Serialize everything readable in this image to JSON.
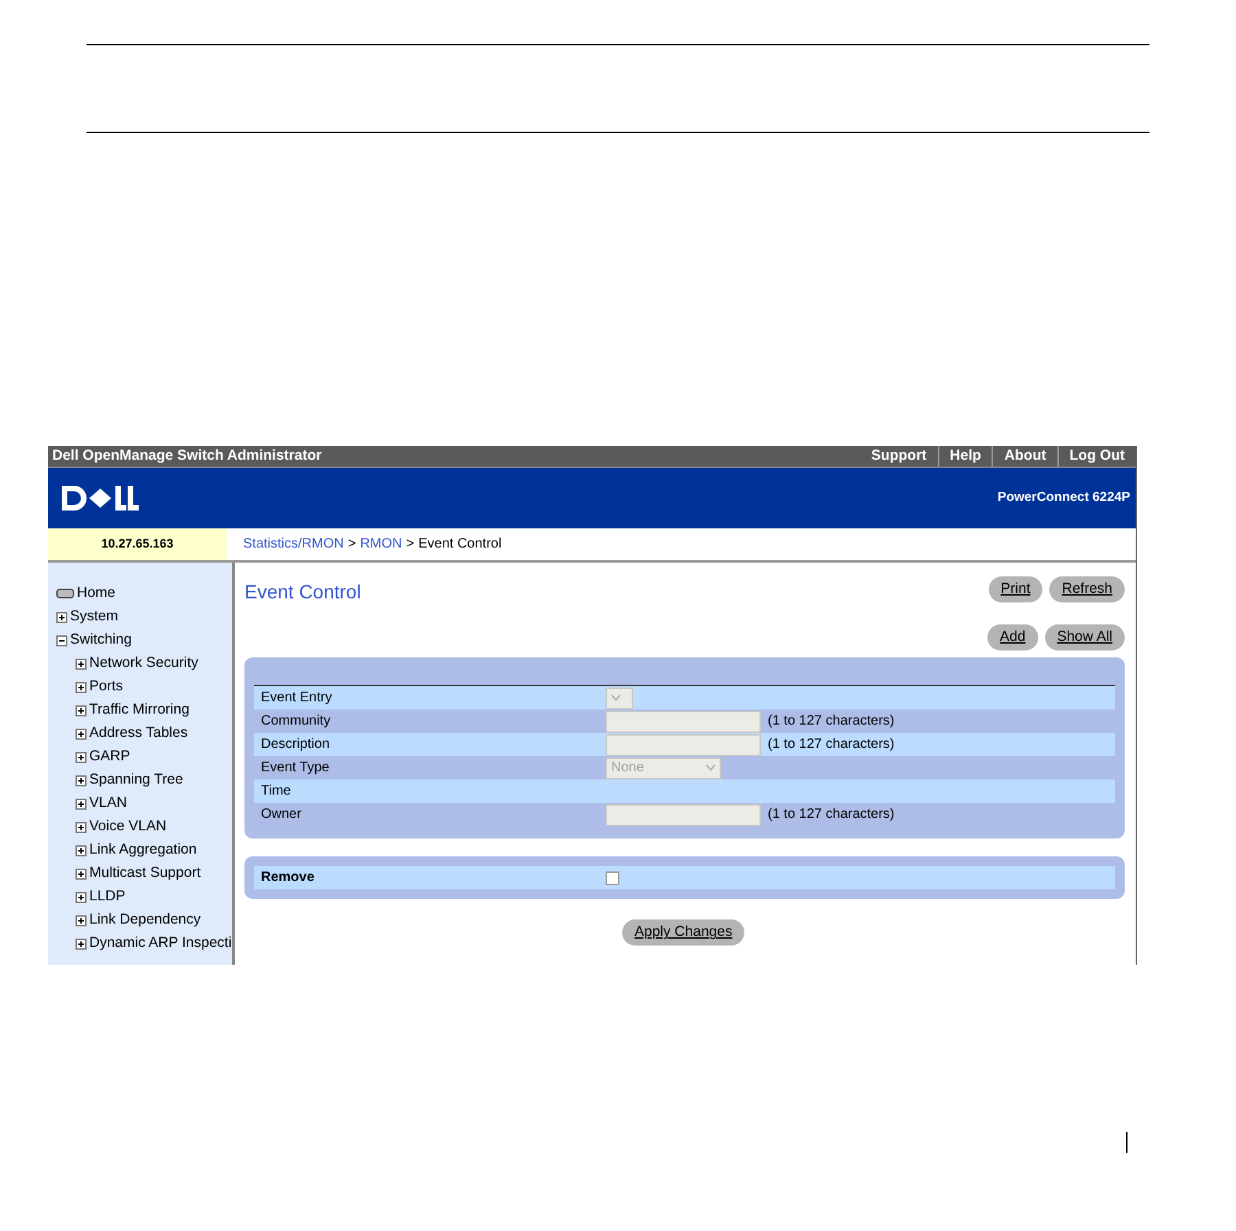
{
  "app_title": "Dell OpenManage Switch Administrator",
  "top_links": [
    "Support",
    "Help",
    "About",
    "Log Out"
  ],
  "product": "PowerConnect 6224P",
  "ip_address": "10.27.65.163",
  "breadcrumb_separator": ">",
  "breadcrumb": [
    {
      "label": "Statistics/RMON",
      "kind": "link"
    },
    {
      "label": "RMON",
      "kind": "link"
    },
    {
      "label": "Event Control",
      "kind": "current"
    }
  ],
  "sidebar": {
    "items": [
      {
        "label": "Home",
        "kind": "home"
      },
      {
        "label": "System",
        "kind": "branch",
        "expanded": false
      },
      {
        "label": "Switching",
        "kind": "branch",
        "expanded": true,
        "children": [
          {
            "label": "Network Security",
            "kind": "branch",
            "expanded": false
          },
          {
            "label": "Ports",
            "kind": "branch",
            "expanded": false
          },
          {
            "label": "Traffic Mirroring",
            "kind": "branch",
            "expanded": false
          },
          {
            "label": "Address Tables",
            "kind": "branch",
            "expanded": false
          },
          {
            "label": "GARP",
            "kind": "branch",
            "expanded": false
          },
          {
            "label": "Spanning Tree",
            "kind": "branch",
            "expanded": false
          },
          {
            "label": "VLAN",
            "kind": "branch",
            "expanded": false
          },
          {
            "label": "Voice VLAN",
            "kind": "branch",
            "expanded": false
          },
          {
            "label": "Link Aggregation",
            "kind": "branch",
            "expanded": false
          },
          {
            "label": "Multicast Support",
            "kind": "branch",
            "expanded": false
          },
          {
            "label": "LLDP",
            "kind": "branch",
            "expanded": false
          },
          {
            "label": "Link Dependency",
            "kind": "branch",
            "expanded": false
          },
          {
            "label": "Dynamic ARP Inspecti",
            "kind": "branch",
            "expanded": false
          }
        ]
      }
    ]
  },
  "page_title": "Event Control",
  "top_buttons": [
    "Print",
    "Refresh"
  ],
  "action_buttons": [
    "Add",
    "Show All"
  ],
  "form_rows": [
    {
      "label": "Event Entry",
      "kind": "select",
      "disabled": true
    },
    {
      "label": "Community",
      "kind": "text",
      "hint": "(1 to 127 characters)",
      "disabled": true
    },
    {
      "label": "Description",
      "kind": "text",
      "hint": "(1 to 127 characters)",
      "disabled": true
    },
    {
      "label": "Event Type",
      "kind": "select",
      "value": "None",
      "disabled": true
    },
    {
      "label": "Time",
      "kind": "none"
    },
    {
      "label": "Owner",
      "kind": "text",
      "hint": "(1 to 127 characters)",
      "disabled": true
    }
  ],
  "remove": {
    "label": "Remove",
    "checked": false
  },
  "apply_button": "Apply Changes"
}
